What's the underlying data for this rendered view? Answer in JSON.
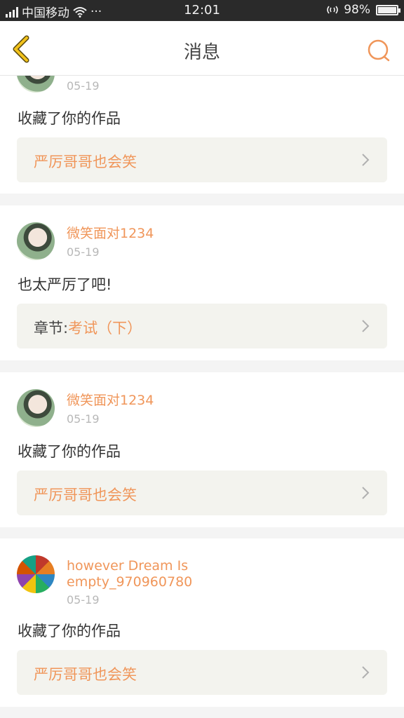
{
  "status_bar": {
    "carrier": "中国移动",
    "dots": "···",
    "time": "12:01",
    "battery": "98%",
    "battery_level": 0.98
  },
  "header": {
    "title": "消息",
    "back_icon": "chevron-left-icon",
    "search_icon": "search-icon",
    "accent_color": "#f0965a",
    "back_color": "#f2c21b"
  },
  "messages": [
    {
      "user": "",
      "date": "05-19",
      "text": "收藏了你的作品",
      "ref_prefix": "",
      "ref_title": "严厉哥哥也会笑"
    },
    {
      "user": "微笑面对1234",
      "date": "05-19",
      "text": "也太严厉了吧!",
      "ref_prefix": "章节:",
      "ref_title": "考试（下）"
    },
    {
      "user": "微笑面对1234",
      "date": "05-19",
      "text": "收藏了你的作品",
      "ref_prefix": "",
      "ref_title": "严厉哥哥也会笑"
    },
    {
      "user_line1": "however Dream Is",
      "user_line2": "empty_970960780",
      "date": "05-19",
      "text": "收藏了你的作品",
      "ref_prefix": "",
      "ref_title": "严厉哥哥也会笑"
    }
  ]
}
